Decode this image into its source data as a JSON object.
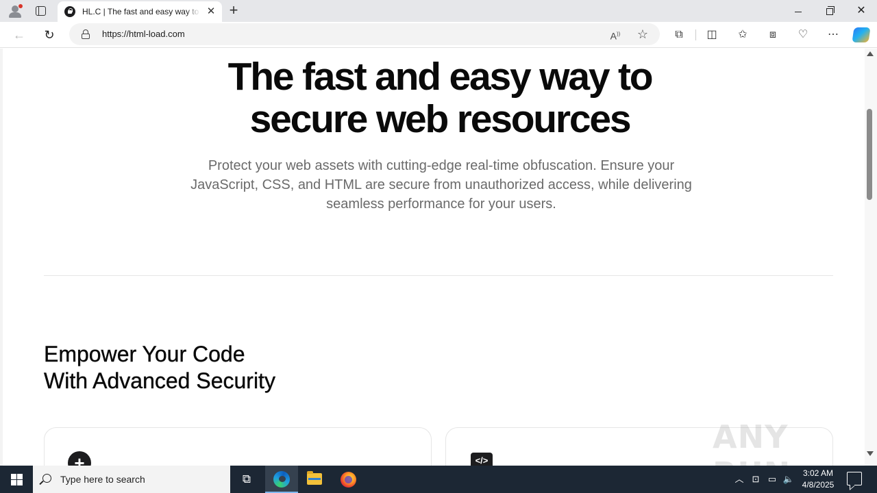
{
  "browser": {
    "tab": {
      "title": "HL.C | The fast and easy way to secure web resources"
    },
    "new_tab_symbol": "+",
    "close_tab_symbol": "✕",
    "window": {
      "close_symbol": "✕"
    },
    "address_bar": {
      "url": "https://html-load.com"
    },
    "nav": {
      "back_symbol": "←",
      "reload_symbol": "↻"
    },
    "toolbar_icons": [
      "extensions-icon",
      "split-screen-icon",
      "favorites-icon",
      "collections-icon",
      "browser-essentials-icon",
      "more-icon",
      "copilot-icon"
    ]
  },
  "page": {
    "hero": {
      "title_line1": "The fast and easy way to",
      "title_line2": "secure web resources",
      "subtitle": "Protect your web assets with cutting-edge real-time obfuscation. Ensure your JavaScript, CSS, and HTML are secure from unauthorized access, while delivering seamless performance for your users."
    },
    "section": {
      "title_line1": "Empower Your Code",
      "title_line2": "With Advanced Security"
    },
    "cards": [
      {
        "icon": "plus-circle-icon"
      },
      {
        "icon": "code-icon"
      }
    ],
    "watermark": "ANY RUN"
  },
  "taskbar": {
    "search_placeholder": "Type here to search",
    "apps": [
      "task-view-icon",
      "edge-icon",
      "file-explorer-icon",
      "firefox-icon"
    ],
    "clock": {
      "time": "3:02 AM",
      "date": "4/8/2025"
    }
  },
  "colors": {
    "tab_strip": "#e6e7ea",
    "taskbar": "#1c2734",
    "hero_text": "#0a0a0a",
    "subtitle_text": "#6a6a6a"
  }
}
